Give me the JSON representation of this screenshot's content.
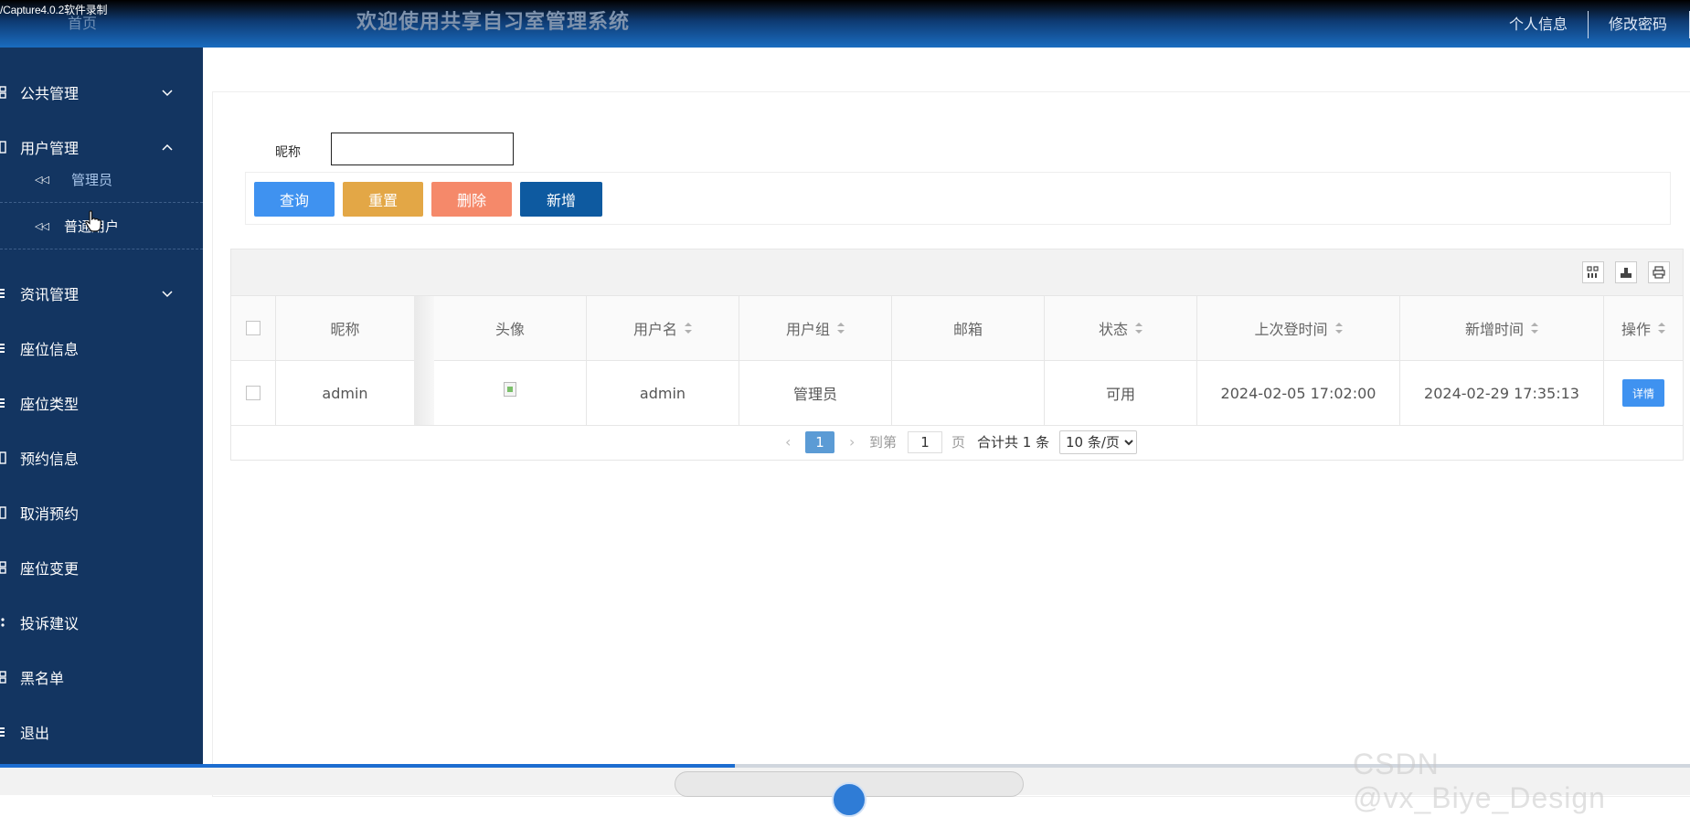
{
  "recorder": {
    "label": "/Capture4.0.2软件录制"
  },
  "header": {
    "home_label": "首页",
    "title": "欢迎使用共享自习室管理系统",
    "links": [
      "个人信息",
      "修改密码"
    ]
  },
  "sidebar": {
    "items": [
      {
        "label": "公共管理",
        "expanded": false
      },
      {
        "label": "用户管理",
        "expanded": true
      },
      {
        "label": "资讯管理",
        "expanded": false
      },
      {
        "label": "座位信息"
      },
      {
        "label": "座位类型"
      },
      {
        "label": "预约信息"
      },
      {
        "label": "取消预约"
      },
      {
        "label": "座位变更"
      },
      {
        "label": "投诉建议"
      },
      {
        "label": "黑名单"
      },
      {
        "label": "退出"
      }
    ],
    "subitems": [
      {
        "label": "管理员",
        "active": true
      },
      {
        "label": "普通用户",
        "active": false
      }
    ],
    "sub_icon": "◁◁"
  },
  "search": {
    "label": "昵称",
    "value": ""
  },
  "buttons": {
    "query": "查询",
    "reset": "重置",
    "delete": "删除",
    "add": "新增"
  },
  "table": {
    "columns": [
      "昵称",
      "头像",
      "用户名",
      "用户组",
      "邮箱",
      "状态",
      "上次登时间",
      "新增时间",
      "操作"
    ],
    "rows": [
      {
        "nickname": "admin",
        "avatar": "broken-image-icon",
        "username": "admin",
        "group": "管理员",
        "email": "",
        "status": "可用",
        "last_login": "2024-02-05 17:02:00",
        "created": "2024-02-29 17:35:13",
        "action": "详情"
      }
    ]
  },
  "pager": {
    "prev": "‹",
    "current": "1",
    "next": "›",
    "goto_label": "到第",
    "goto_value": "1",
    "page_label": "页",
    "total": "合计共 1 条",
    "page_size": "10 条/页"
  },
  "overlay": {
    "watermark": "CSDN @vx_Biye_Design",
    "progress_fraction": 0.435
  },
  "colors": {
    "sidebar_bg": "#133561",
    "header_blue": "#1a6cc0",
    "btn_query": "#3f92f0",
    "btn_reset": "#e3a746",
    "btn_delete": "#f5896a",
    "btn_add": "#0e5aa0"
  }
}
